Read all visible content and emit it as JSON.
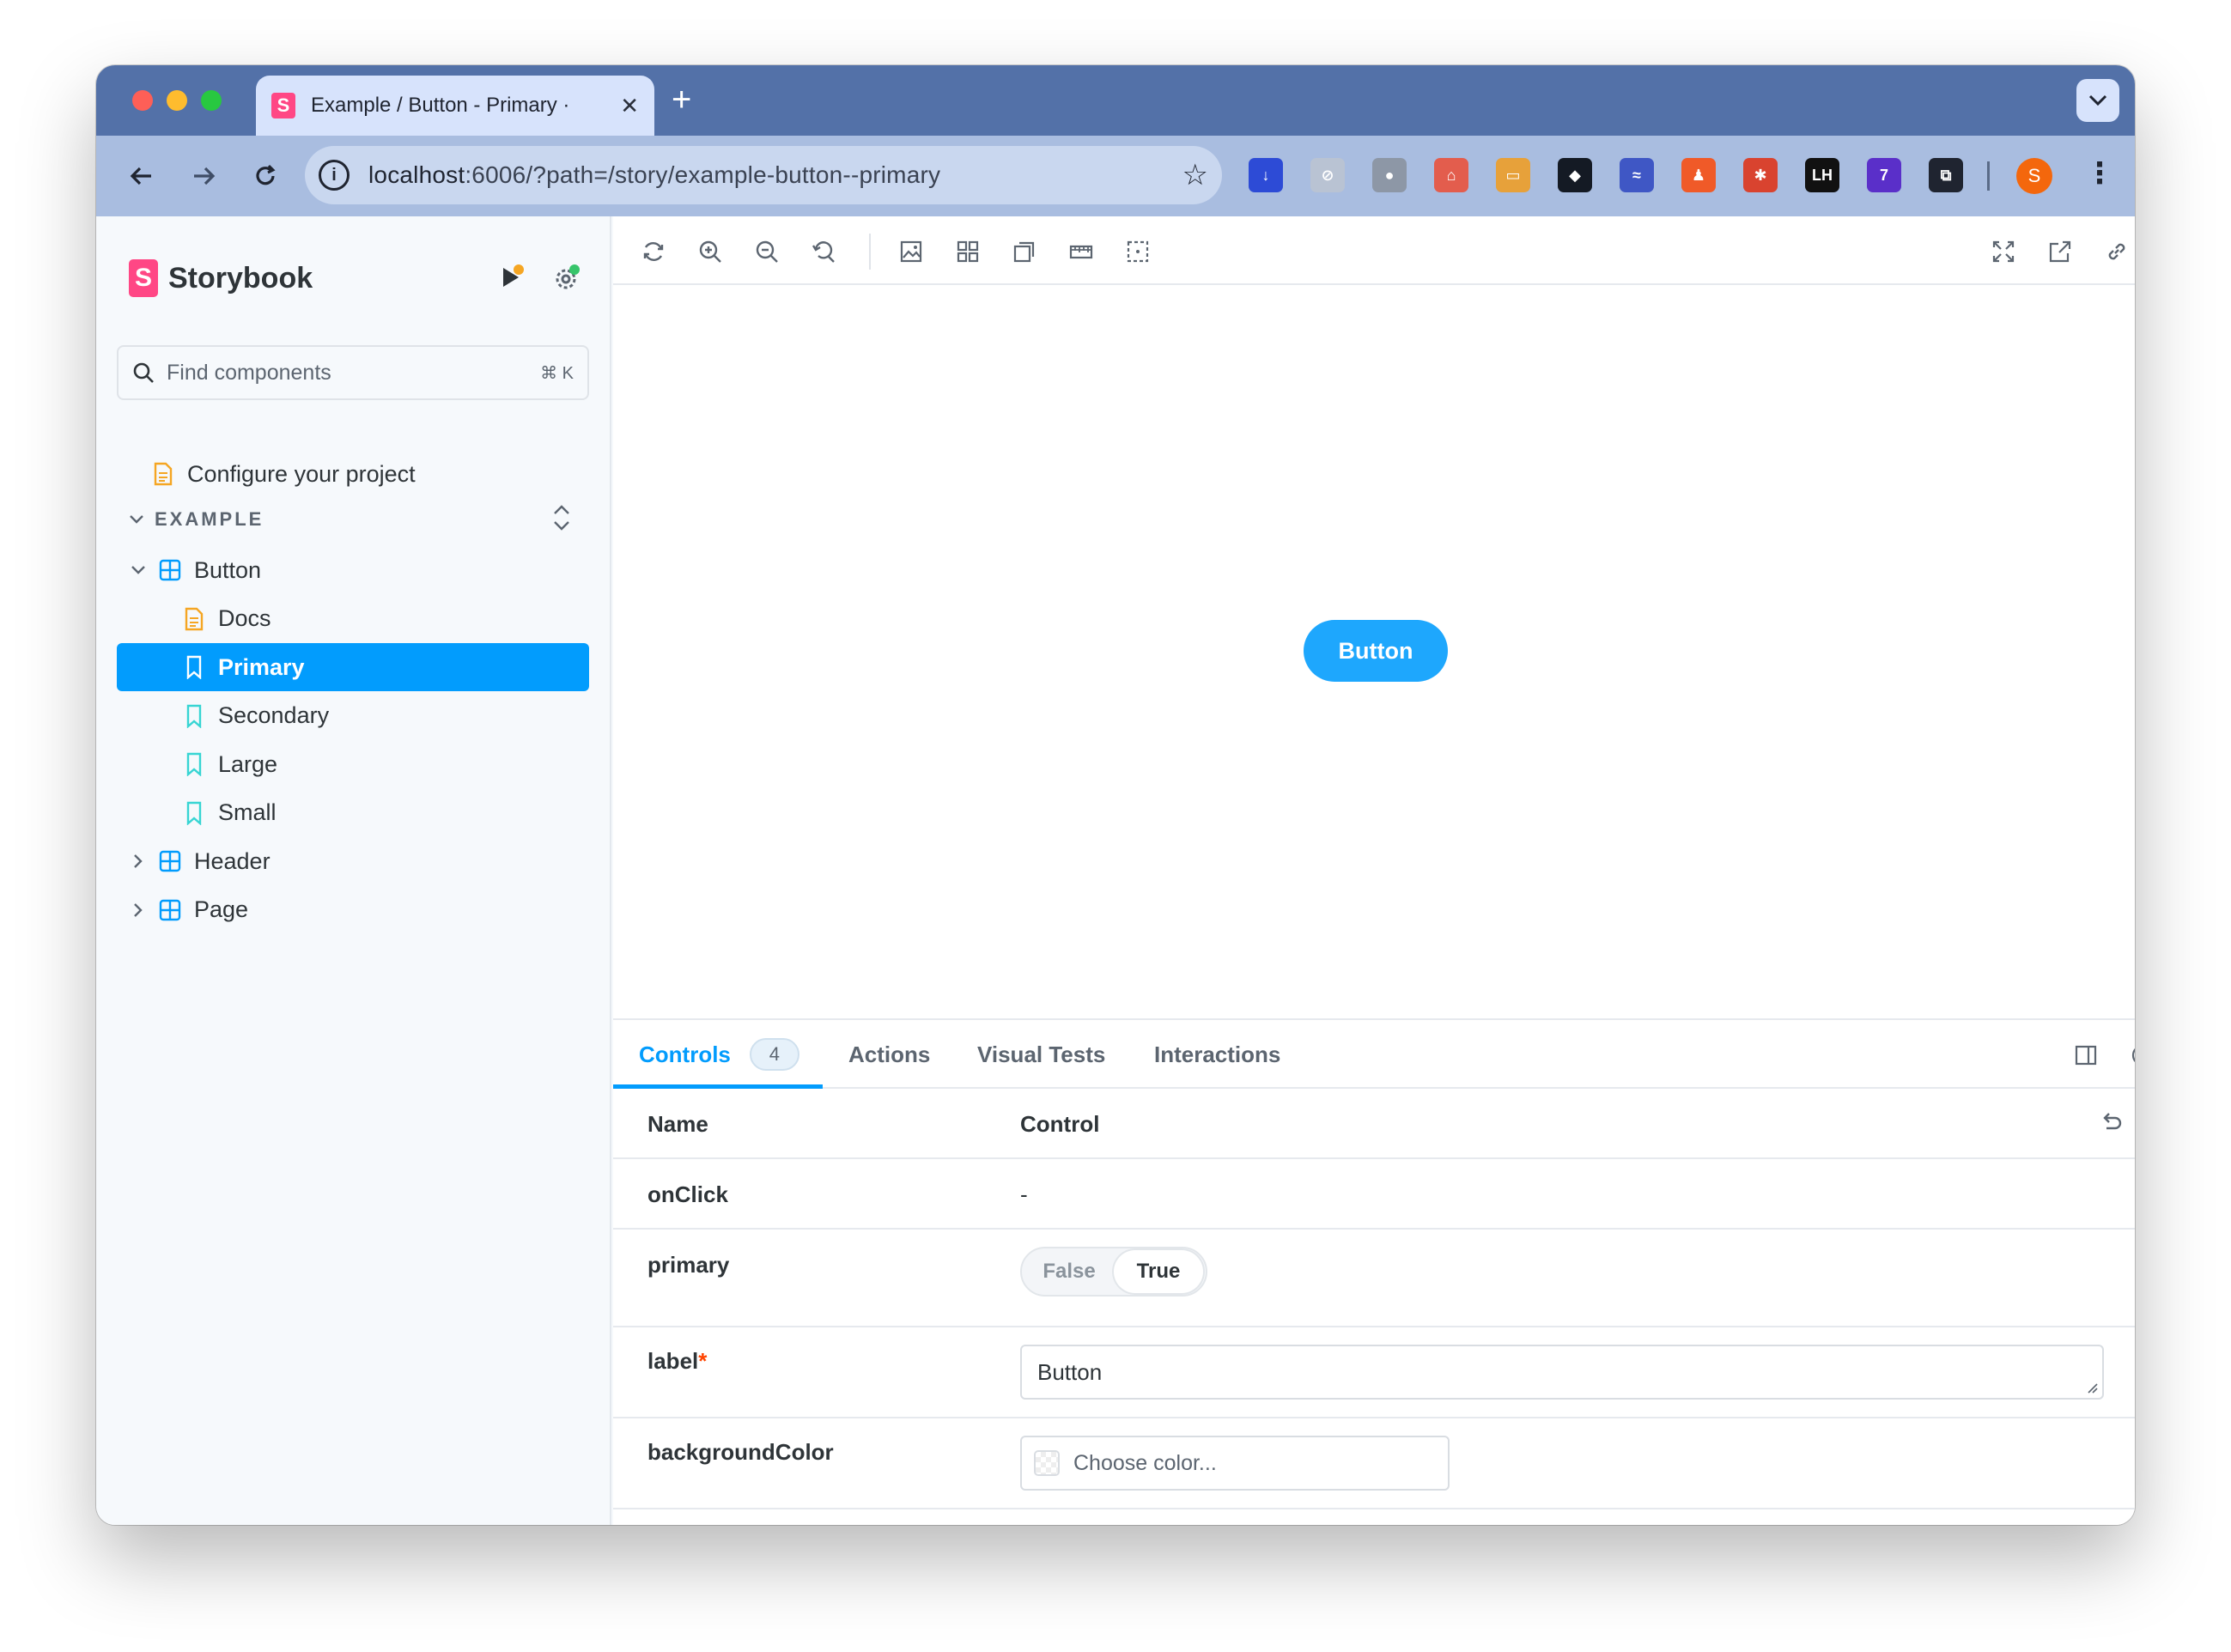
{
  "browser": {
    "tab_title": "Example / Button - Primary ·",
    "tab_favicon": "S",
    "new_tab": "+",
    "url_host": "localhost",
    "url_rest": ":6006/?path=/story/example-button--primary",
    "avatar_initial": "S",
    "extensions": [
      {
        "name": "download-extension-icon",
        "color": "#2d4bd6",
        "label": "↓"
      },
      {
        "name": "disabled-extension-icon",
        "color": "#b9c3d3",
        "label": "⊘"
      },
      {
        "name": "camera-extension-icon",
        "color": "#8d97a6",
        "label": "●"
      },
      {
        "name": "sitemap-extension-icon",
        "color": "#e35d4d",
        "label": "⌂"
      },
      {
        "name": "gallery-extension-icon",
        "color": "#e7a13a",
        "label": "▭"
      },
      {
        "name": "cube-extension-icon",
        "color": "#141a24",
        "label": "◆"
      },
      {
        "name": "wifi-extension-icon",
        "color": "#3f57c5",
        "label": "≈"
      },
      {
        "name": "character-extension-icon",
        "color": "#f05a28",
        "label": "♟"
      },
      {
        "name": "bug-extension-icon",
        "color": "#d9432f",
        "label": "✱"
      },
      {
        "name": "lighthouse-extension-icon",
        "color": "#111111",
        "label": "LH"
      },
      {
        "name": "graduation-extension-icon",
        "color": "#5a2fc9",
        "label": "7"
      },
      {
        "name": "puzzle-extension-icon",
        "color": "#1f2430",
        "label": "⧉"
      }
    ]
  },
  "sidebar": {
    "brand": "Storybook",
    "search_placeholder": "Find components",
    "search_shortcut": "⌘ K",
    "configure": "Configure your project",
    "section": "EXAMPLE",
    "tree": [
      {
        "label": "Button",
        "kind": "component",
        "expanded": true
      },
      {
        "label": "Docs",
        "kind": "docs"
      },
      {
        "label": "Primary",
        "kind": "story",
        "selected": true
      },
      {
        "label": "Secondary",
        "kind": "story"
      },
      {
        "label": "Large",
        "kind": "story"
      },
      {
        "label": "Small",
        "kind": "story"
      },
      {
        "label": "Header",
        "kind": "component",
        "expanded": false
      },
      {
        "label": "Page",
        "kind": "component",
        "expanded": false
      }
    ]
  },
  "preview": {
    "button_label": "Button",
    "button_color": "#1ea7fd"
  },
  "addons": {
    "tabs": [
      {
        "label": "Controls",
        "badge": "4",
        "active": true
      },
      {
        "label": "Actions"
      },
      {
        "label": "Visual Tests"
      },
      {
        "label": "Interactions"
      }
    ],
    "columns": {
      "name": "Name",
      "control": "Control"
    },
    "controls": {
      "onclick": {
        "name": "onClick",
        "value": "-"
      },
      "primary": {
        "name": "primary",
        "false_label": "False",
        "true_label": "True",
        "value": true
      },
      "label": {
        "name": "label",
        "required": "*",
        "value": "Button"
      },
      "background": {
        "name": "backgroundColor",
        "placeholder": "Choose color..."
      }
    }
  },
  "colors": {
    "accent": "#029cfd",
    "brand": "#ff4785",
    "titlebar": "#5371a8"
  }
}
